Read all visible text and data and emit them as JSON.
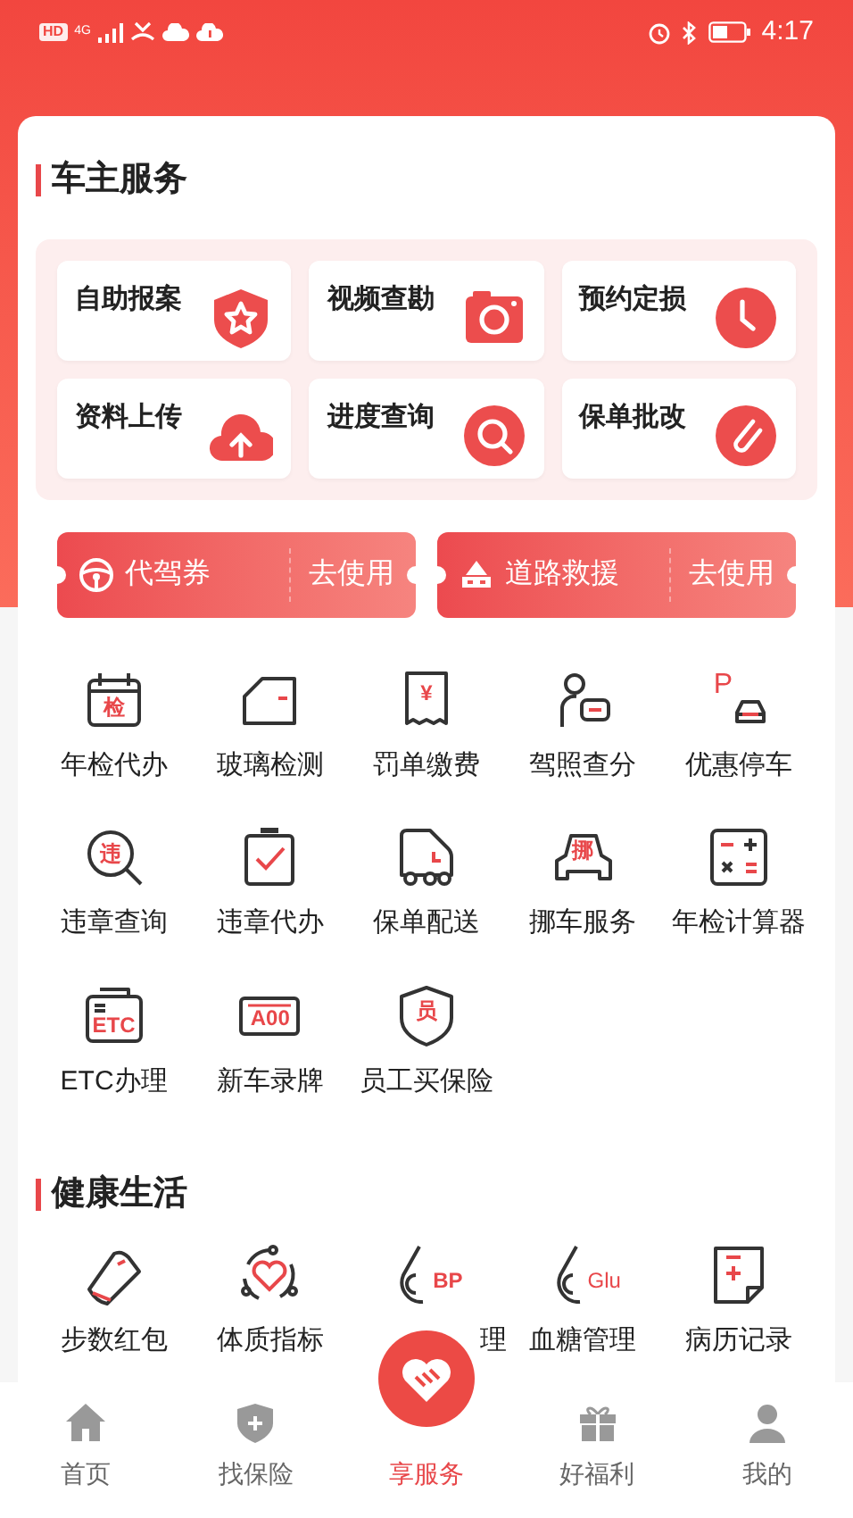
{
  "status_bar": {
    "hd_badge": "HD",
    "network": "4G",
    "time": "4:17"
  },
  "car_owner_services": {
    "title": "车主服务",
    "tiles": [
      {
        "label": "自助报案"
      },
      {
        "label": "视频查勘"
      },
      {
        "label": "预约定损"
      },
      {
        "label": "资料上传"
      },
      {
        "label": "进度查询"
      },
      {
        "label": "保单批改"
      }
    ],
    "coupons": [
      {
        "label": "代驾券",
        "action": "去使用"
      },
      {
        "label": "道路救援",
        "action": "去使用"
      }
    ],
    "services": [
      {
        "label": "年检代办",
        "icon_text": "检"
      },
      {
        "label": "玻璃检测"
      },
      {
        "label": "罚单缴费",
        "icon_text": "¥"
      },
      {
        "label": "驾照查分"
      },
      {
        "label": "优惠停车",
        "icon_text": "P"
      },
      {
        "label": "违章查询",
        "icon_text": "违"
      },
      {
        "label": "违章代办"
      },
      {
        "label": "保单配送"
      },
      {
        "label": "挪车服务",
        "icon_text": "挪"
      },
      {
        "label": "年检计算器"
      },
      {
        "label": "ETC办理",
        "icon_text": "ETC"
      },
      {
        "label": "新车录牌",
        "icon_text": "A00"
      },
      {
        "label": "员工买保险",
        "icon_text": "员"
      }
    ]
  },
  "health_life": {
    "title": "健康生活",
    "services": [
      {
        "label": "步数红包"
      },
      {
        "label": "体质指标"
      },
      {
        "label": "理",
        "icon_text": "BP",
        "partly_covered": true
      },
      {
        "label": "血糖管理",
        "icon_text": "Glu"
      },
      {
        "label": "病历记录"
      }
    ]
  },
  "bottom_nav": [
    {
      "label": "首页",
      "selected": false
    },
    {
      "label": "找保险",
      "selected": false
    },
    {
      "label": "享服务",
      "selected": true
    },
    {
      "label": "好福利",
      "selected": false
    },
    {
      "label": "我的",
      "selected": false
    }
  ]
}
